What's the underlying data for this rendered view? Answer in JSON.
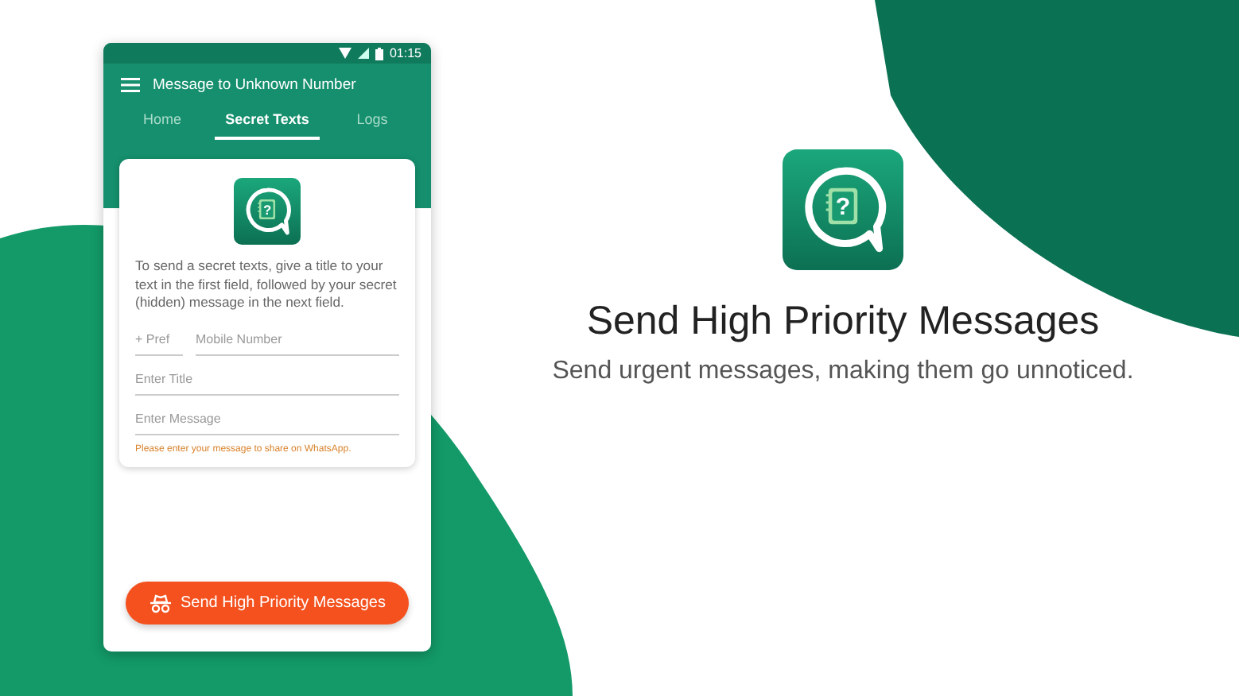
{
  "status_bar": {
    "time": "01:15"
  },
  "app_bar": {
    "title": "Message to Unknown Number"
  },
  "tabs": [
    {
      "label": "Home",
      "selected": false
    },
    {
      "label": "Secret Texts",
      "selected": true
    },
    {
      "label": "Logs",
      "selected": false
    }
  ],
  "card": {
    "icon_glyph": "?",
    "description": "To send a secret texts, give a title to your text in the first field, followed by your secret (hidden) message in the next field.",
    "prefix_field": {
      "placeholder": "+ Pref"
    },
    "number_field": {
      "placeholder": "Mobile Number"
    },
    "title_field": {
      "placeholder": "Enter Title"
    },
    "message_field": {
      "placeholder": "Enter Message"
    },
    "hint": "Please enter your message to share on WhatsApp."
  },
  "send_button": {
    "label": "Send High Priority Messages"
  },
  "promo": {
    "icon_glyph": "?",
    "title": "Send High Priority Messages",
    "subtitle": "Send urgent messages, making them go unnoticed."
  }
}
